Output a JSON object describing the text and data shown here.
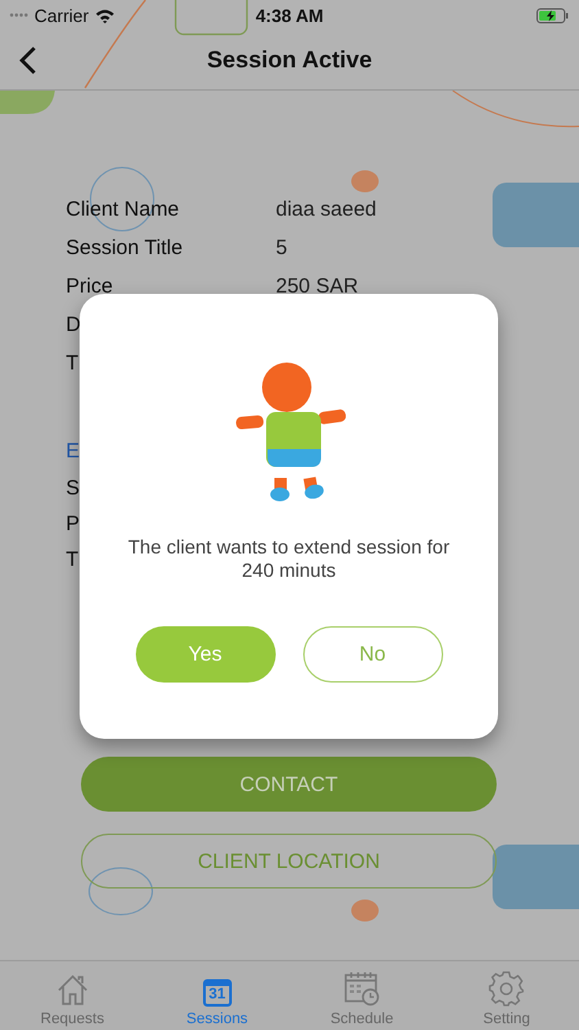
{
  "status_bar": {
    "carrier": "Carrier",
    "time": "4:38 AM"
  },
  "nav": {
    "title": "Session Active"
  },
  "details": [
    {
      "label": "Client Name",
      "value": "diaa saeed"
    },
    {
      "label": "Session Title",
      "value": "5"
    },
    {
      "label": "Price",
      "value": "250 SAR"
    },
    {
      "label": "D"
    },
    {
      "label": "T"
    }
  ],
  "section_2": {
    "heading": "E",
    "rows": [
      {
        "label": "S"
      },
      {
        "label": "P"
      },
      {
        "label": "T"
      }
    ]
  },
  "actions": [
    {
      "label": "CONTACT",
      "kind": "filled"
    },
    {
      "label": "CLIENT LOCATION",
      "kind": "outline"
    }
  ],
  "dialog": {
    "message": "The client wants to extend session for 240 minuts",
    "buttons": [
      {
        "label": "Yes",
        "kind": "primary"
      },
      {
        "label": "No",
        "kind": "outline"
      }
    ]
  },
  "tabs": [
    {
      "label": "Requests",
      "selected": false
    },
    {
      "label": "Sessions",
      "selected": true,
      "calendar_day": "31"
    },
    {
      "label": "Schedule",
      "selected": false
    },
    {
      "label": "Setting",
      "selected": false
    }
  ]
}
